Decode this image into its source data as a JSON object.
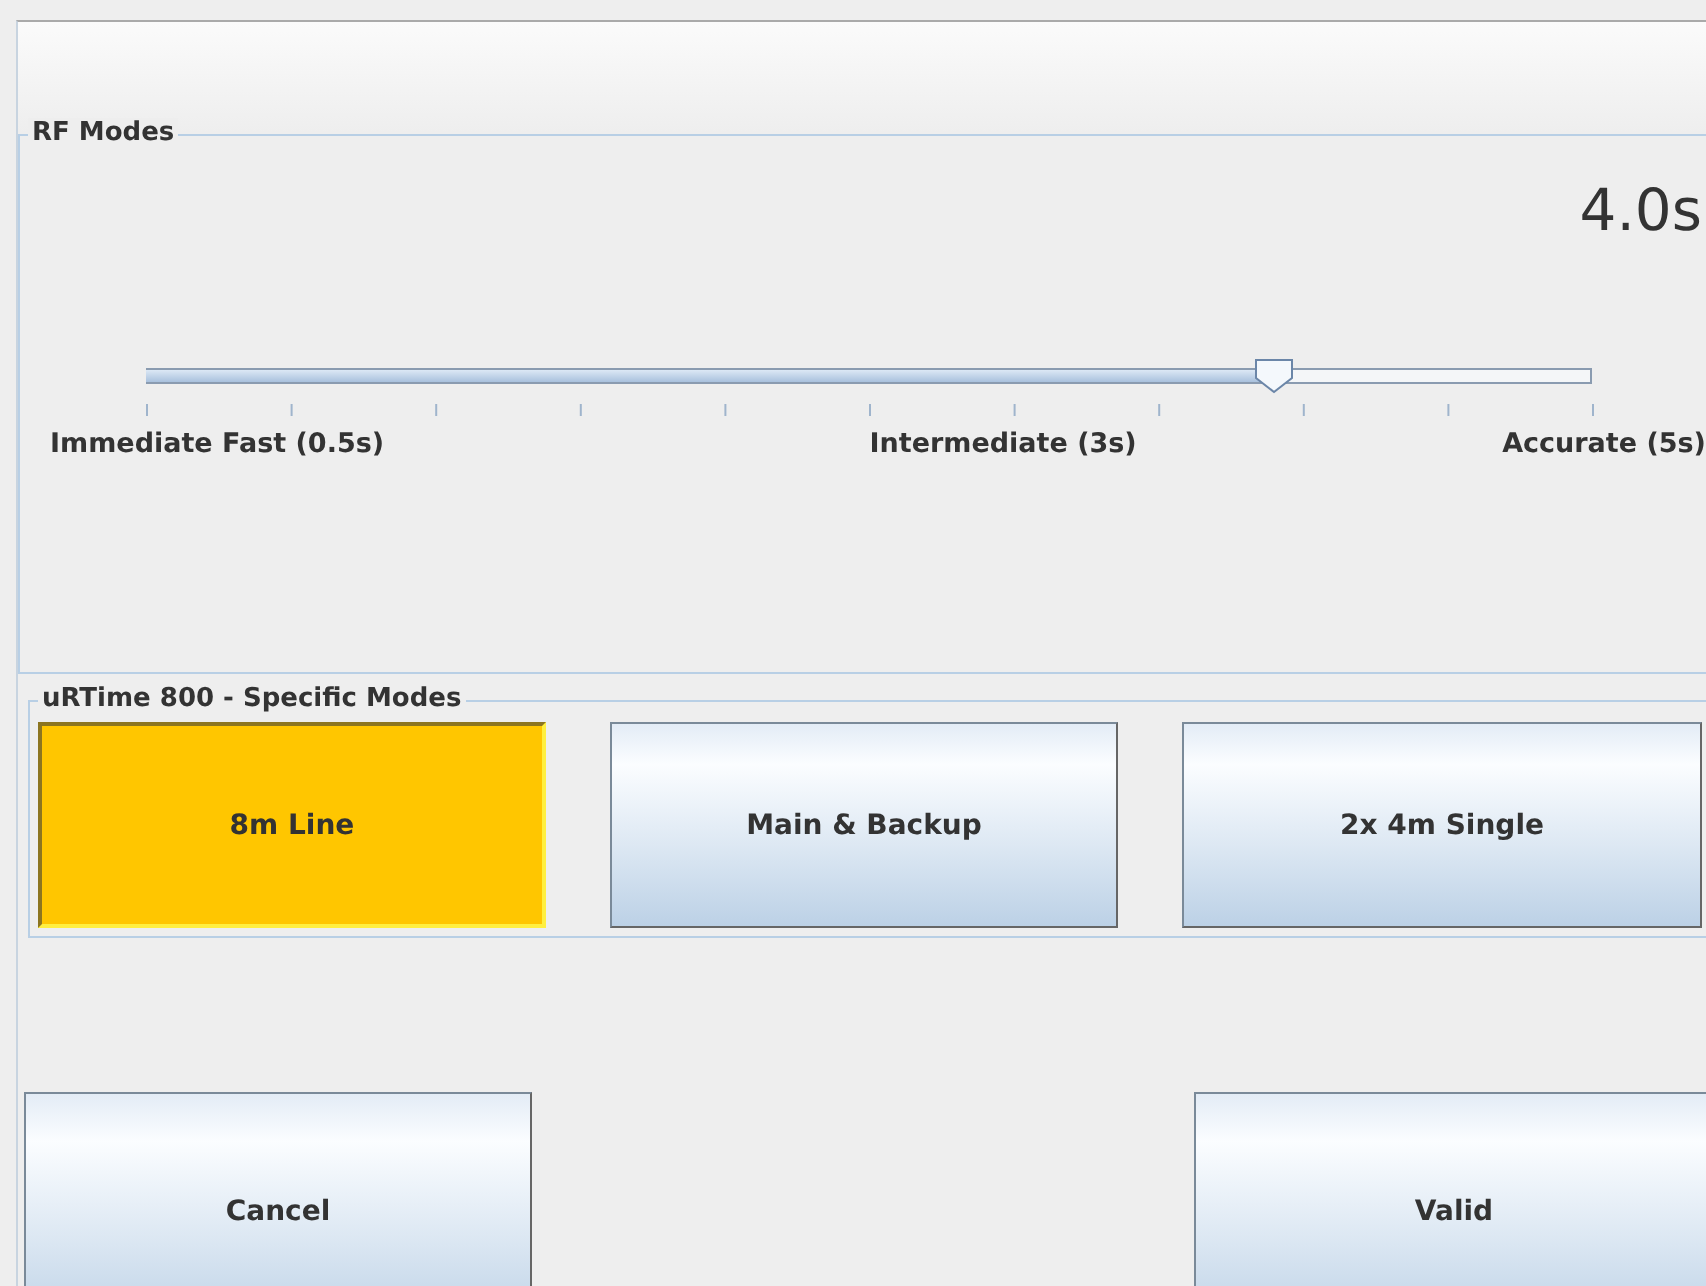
{
  "rf_modes": {
    "title": "RF Modes",
    "reading": "4.0s",
    "slider": {
      "level": 0.78,
      "labels": [
        "Immediate Fast (0.5s)",
        "Intermediate (3s)",
        "Accurate (5s)"
      ]
    }
  },
  "specific_modes": {
    "title": "uRTime 800 - Specific Modes",
    "buttons": [
      {
        "label": "8m Line",
        "selected": true
      },
      {
        "label": "Main & Backup",
        "selected": false
      },
      {
        "label": "2x 4m Single",
        "selected": false
      }
    ]
  },
  "buttons": [
    "Cancel",
    "Valid"
  ]
}
